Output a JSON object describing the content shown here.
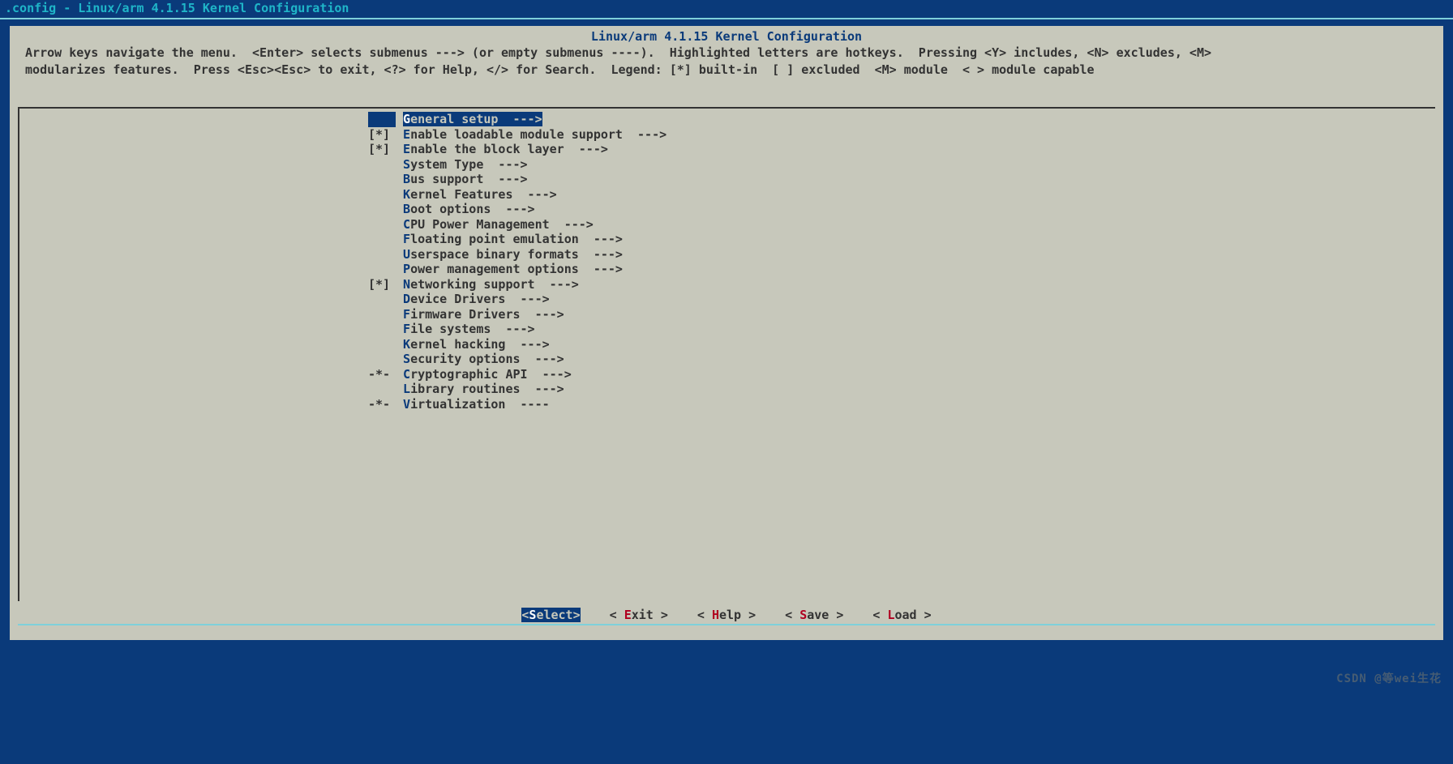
{
  "window": {
    "title": ".config - Linux/arm 4.1.15 Kernel Configuration"
  },
  "panel": {
    "title": "Linux/arm 4.1.15 Kernel Configuration",
    "help1": " Arrow keys navigate the menu.  <Enter> selects submenus ---> (or empty submenus ----).  Highlighted letters are hotkeys.  Pressing <Y> includes, <N> excludes, <M>",
    "help2": " modularizes features.  Press <Esc><Esc> to exit, <?> for Help, </> for Search.  Legend: [*] built-in  [ ] excluded  <M> module  < > module capable"
  },
  "menu": {
    "items": [
      {
        "prefix": "   ",
        "hot": "G",
        "rest": "eneral setup  --->",
        "selected": true
      },
      {
        "prefix": "[*]",
        "hot": "E",
        "rest": "nable loadable module support  --->",
        "selected": false
      },
      {
        "prefix": "[*]",
        "hot": "E",
        "rest": "nable the block layer  --->",
        "selected": false
      },
      {
        "prefix": "   ",
        "hot": "S",
        "rest": "ystem Type  --->",
        "selected": false
      },
      {
        "prefix": "   ",
        "hot": "B",
        "rest": "us support  --->",
        "selected": false
      },
      {
        "prefix": "   ",
        "hot": "K",
        "rest": "ernel Features  --->",
        "selected": false
      },
      {
        "prefix": "   ",
        "hot": "B",
        "rest": "oot options  --->",
        "selected": false
      },
      {
        "prefix": "   ",
        "hot": "C",
        "rest": "PU Power Management  --->",
        "selected": false
      },
      {
        "prefix": "   ",
        "hot": "F",
        "rest": "loating point emulation  --->",
        "selected": false
      },
      {
        "prefix": "   ",
        "hot": "U",
        "rest": "serspace binary formats  --->",
        "selected": false
      },
      {
        "prefix": "   ",
        "hot": "P",
        "rest": "ower management options  --->",
        "selected": false
      },
      {
        "prefix": "[*]",
        "hot": "N",
        "rest": "etworking support  --->",
        "selected": false
      },
      {
        "prefix": "   ",
        "hot": "D",
        "rest": "evice Drivers  --->",
        "selected": false
      },
      {
        "prefix": "   ",
        "hot": "F",
        "rest": "irmware Drivers  --->",
        "selected": false
      },
      {
        "prefix": "   ",
        "hot": "F",
        "rest": "ile systems  --->",
        "selected": false
      },
      {
        "prefix": "   ",
        "hot": "K",
        "rest": "ernel hacking  --->",
        "selected": false
      },
      {
        "prefix": "   ",
        "hot": "S",
        "rest": "ecurity options  --->",
        "selected": false
      },
      {
        "prefix": "-*-",
        "hot": "C",
        "rest": "ryptographic API  --->",
        "selected": false
      },
      {
        "prefix": "   ",
        "hot": "L",
        "rest": "ibrary routines  --->",
        "selected": false
      },
      {
        "prefix": "-*-",
        "hot": "V",
        "rest": "irtualization  ----",
        "selected": false
      }
    ]
  },
  "buttons": {
    "items": [
      {
        "pre": "<",
        "hot": "S",
        "post": "elect>",
        "selected": true,
        "name": "select-button"
      },
      {
        "pre": "< ",
        "hot": "E",
        "post": "xit >",
        "selected": false,
        "name": "exit-button"
      },
      {
        "pre": "< ",
        "hot": "H",
        "post": "elp >",
        "selected": false,
        "name": "help-button"
      },
      {
        "pre": "< ",
        "hot": "S",
        "post": "ave >",
        "selected": false,
        "name": "save-button"
      },
      {
        "pre": "< ",
        "hot": "L",
        "post": "oad >",
        "selected": false,
        "name": "load-button"
      }
    ]
  },
  "watermark": "CSDN @等wei生花"
}
